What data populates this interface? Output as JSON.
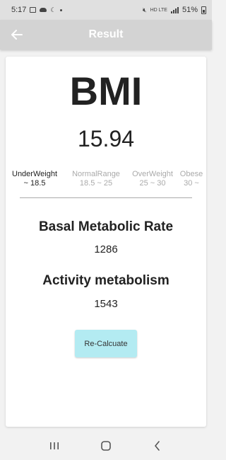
{
  "status_bar": {
    "time": "5:17",
    "network": "HD LTE",
    "battery": "51%"
  },
  "app_bar": {
    "title": "Result"
  },
  "result": {
    "heading": "BMI",
    "bmi_value": "15.94",
    "ranges": [
      {
        "label": "UnderWeight",
        "range": "~ 18.5",
        "active": true
      },
      {
        "label": "NormalRange",
        "range": "18.5 ~ 25",
        "active": false
      },
      {
        "label": "OverWeight",
        "range": "25 ~ 30",
        "active": false
      },
      {
        "label": "Obese",
        "range": "30 ~",
        "active": false
      }
    ],
    "bmr_label": "Basal Metabolic Rate",
    "bmr_value": "1286",
    "activity_label": "Activity metabolism",
    "activity_value": "1543",
    "recalc_label": "Re-Calcuate"
  },
  "colors": {
    "app_bar": "#d3d3d3",
    "button": "#b3ebf2",
    "inactive_range": "#aaaaaa"
  }
}
